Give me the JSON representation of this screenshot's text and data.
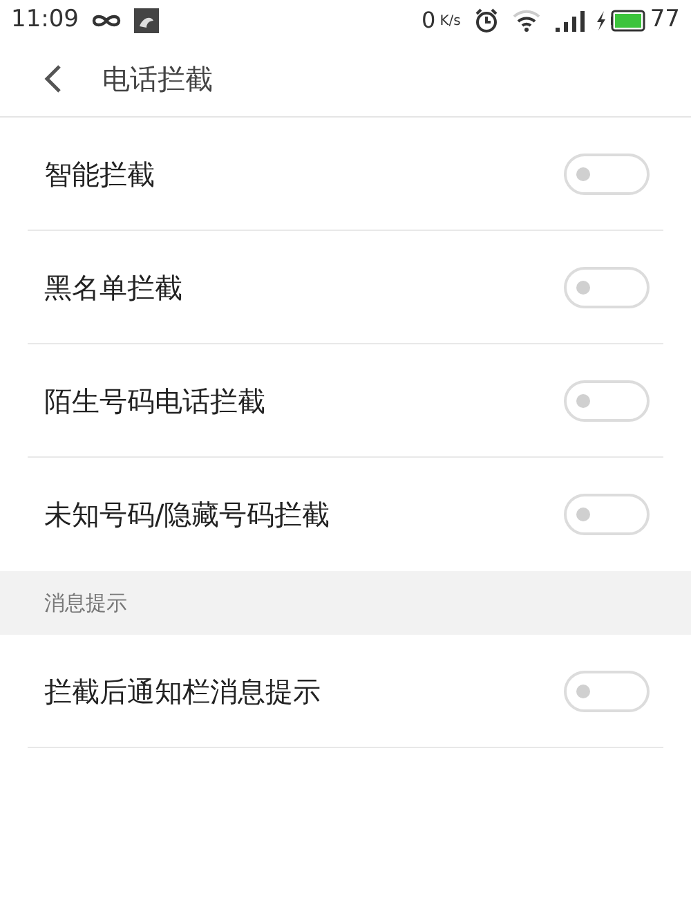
{
  "status_bar": {
    "time": "11:09",
    "speed_value": "0",
    "speed_unit": "K/s",
    "battery": "77"
  },
  "header": {
    "title": "电话拦截"
  },
  "sections": [
    {
      "items": [
        {
          "label": "智能拦截",
          "on": false
        },
        {
          "label": "黑名单拦截",
          "on": false
        },
        {
          "label": "陌生号码电话拦截",
          "on": false
        },
        {
          "label": "未知号码/隐藏号码拦截",
          "on": false
        }
      ]
    },
    {
      "title": "消息提示",
      "items": [
        {
          "label": "拦截后通知栏消息提示",
          "on": false
        }
      ]
    }
  ]
}
